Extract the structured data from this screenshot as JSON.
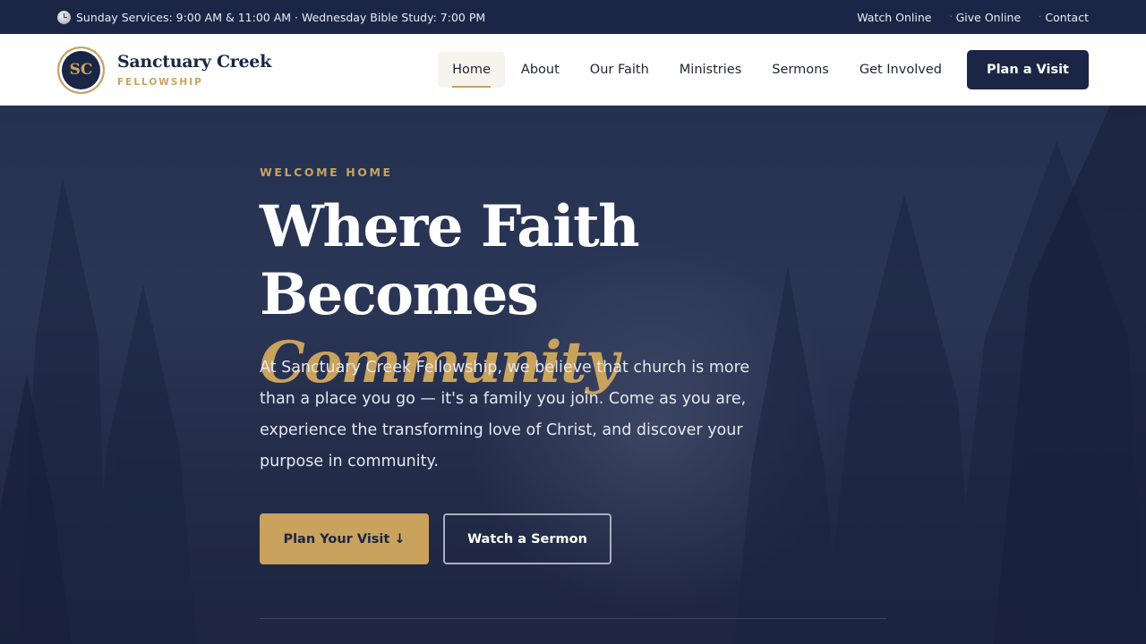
{
  "topbar": {
    "service_times": "Sunday Services: 9:00 AM & 11:00 AM · Wednesday Bible Study: 7:00 PM",
    "links": [
      "Watch Online",
      "Give Online",
      "Contact"
    ],
    "separator": "·"
  },
  "brand": {
    "monogram": "SC",
    "name": "Sanctuary Creek",
    "subtitle": "FELLOWSHIP"
  },
  "nav": {
    "items": [
      "Home",
      "About",
      "Our Faith",
      "Ministries",
      "Sermons",
      "Get Involved"
    ],
    "active": "Home",
    "cta": "Plan a Visit"
  },
  "hero": {
    "eyebrow": "WELCOME HOME",
    "headline_line1": "Where Faith Becomes",
    "headline_line2": "Community",
    "lead": "At Sanctuary Creek Fellowship, we believe that church is more than a place you go — it's a family you join. Come as you are, experience the transforming love of Christ, and discover your purpose in community.",
    "primary_button": "Plan Your Visit ↓",
    "secondary_button": "Watch a Sermon"
  },
  "colors": {
    "navy": "#1b2646",
    "gold": "#c9a25d",
    "white": "#ffffff"
  },
  "icons": {
    "service_times": "clock-icon"
  }
}
